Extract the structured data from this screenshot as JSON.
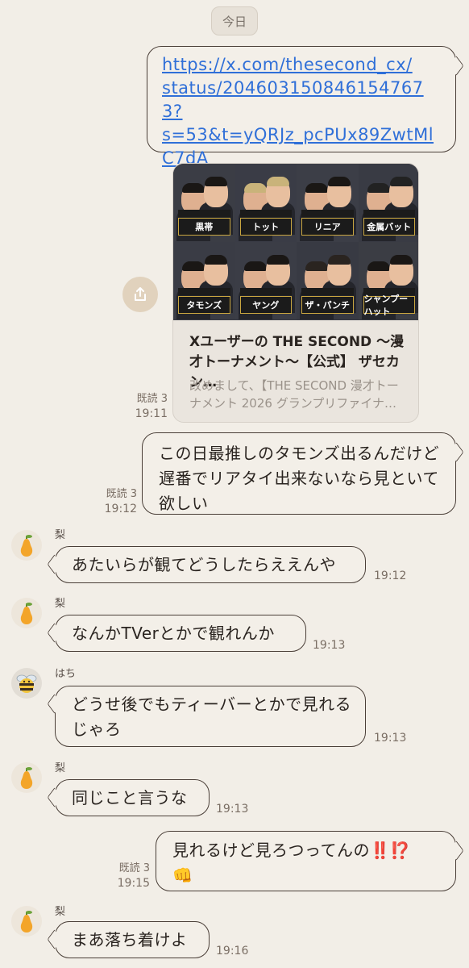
{
  "date_label": "今日",
  "messages": {
    "m1": {
      "link": "https://x.com/thesecond_cx/status/2046031508461547673?s=53&t=yQRJz_pcPUx89ZwtMlC7dA",
      "line1": "https://x.com/thesecond_cx/",
      "line2": "status/2046031508461547673?",
      "line3": "s=53&t=yQRJz_pcPUx89ZwtMl",
      "line4": "C7dA"
    },
    "m2": {
      "card_title": "Xユーザーの THE SECOND 〜漫才トーナメント〜【公式】 ザセカン…",
      "card_desc": "改めまして、【THE SECOND 漫才トーナメント 2026 グランプリファイナ…",
      "read": "既読 3",
      "time": "19:11",
      "names": [
        "黒帯",
        "トット",
        "リニア",
        "金属バット",
        "タモンズ",
        "ヤング",
        "ザ・パンチ",
        "シャンプーハット"
      ]
    },
    "m3": {
      "text": "この日最推しのタモンズ出るんだけど遅番でリアタイ出来ないなら見といて欲しい",
      "read": "既読 3",
      "time": "19:12"
    },
    "m4": {
      "sender": "梨",
      "text": "あたいらが観てどうしたらええんや",
      "time": "19:12"
    },
    "m5": {
      "sender": "梨",
      "text": "なんかTVerとかで観れんか",
      "time": "19:13"
    },
    "m6": {
      "sender": "はち",
      "text": "どうせ後でもティーバーとかで見れるじゃろ",
      "time": "19:13"
    },
    "m7": {
      "sender": "梨",
      "text": "同じこと言うな",
      "time": "19:13"
    },
    "m8": {
      "text": "見れるけど見ろつってんの",
      "emoji": "‼️⁉️",
      "emoji2": "👊",
      "read": "既読 3",
      "time": "19:15"
    },
    "m9": {
      "sender": "梨",
      "text": "まあ落ち着けよ",
      "time": "19:16"
    }
  },
  "colors": {
    "background": "#f2eee7",
    "bubble": "#f3efe8",
    "border": "#4a3f38",
    "link": "#2f6fd8"
  }
}
